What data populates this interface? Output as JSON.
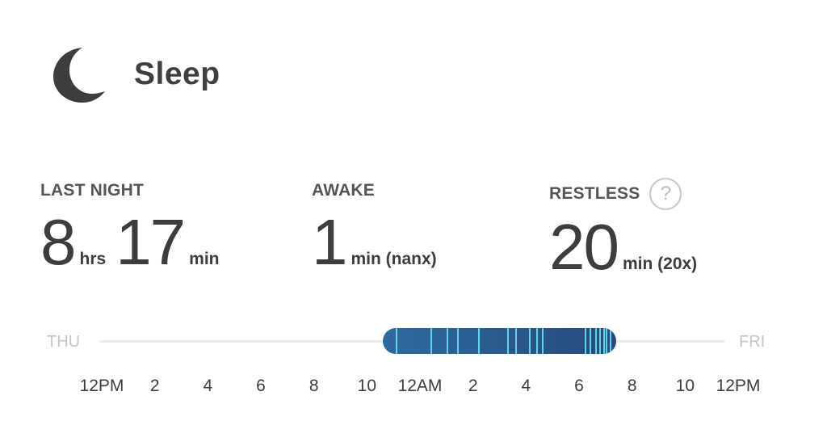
{
  "header": {
    "title": "Sleep",
    "icon": "moon-icon"
  },
  "stats": {
    "last_night": {
      "label": "LAST NIGHT",
      "hours": "8",
      "hours_unit": "hrs",
      "minutes": "17",
      "minutes_unit": "min"
    },
    "awake": {
      "label": "AWAKE",
      "value": "1",
      "unit": "min (nanx)"
    },
    "restless": {
      "label": "RESTLESS",
      "help": "?",
      "value": "20",
      "unit": "min (20x)"
    }
  },
  "timeline": {
    "start_day": "THU",
    "end_day": "FRI",
    "ticks": [
      "12PM",
      "2",
      "4",
      "6",
      "8",
      "10",
      "12AM",
      "2",
      "4",
      "6",
      "8",
      "10",
      "12PM"
    ],
    "sleep_start_hour": 10.6,
    "sleep_end_hour": 19.4,
    "restless_marks_hours": [
      11.1,
      12.4,
      13.0,
      13.4,
      14.2,
      15.3,
      15.6,
      16.1,
      16.4,
      16.6,
      18.2,
      18.4,
      18.6,
      18.75,
      18.9,
      19.0,
      19.15
    ],
    "colors": {
      "bar_start": "#2d6a9f",
      "bar_end": "#274a7c",
      "restless": "#5fd6e4",
      "track": "#ececec"
    }
  }
}
